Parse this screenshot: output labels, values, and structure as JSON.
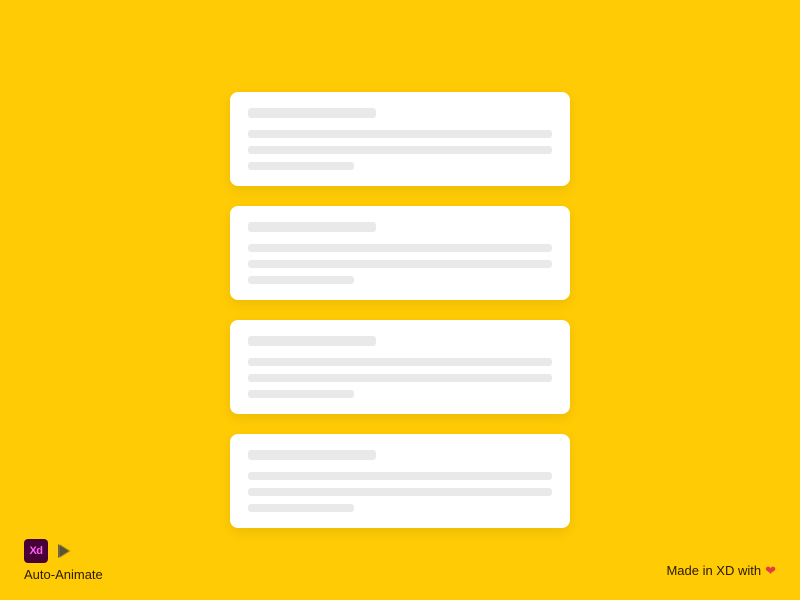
{
  "cards": [
    {
      "title_width": "42%",
      "line3_width": "35%"
    },
    {
      "title_width": "42%",
      "line3_width": "35%"
    },
    {
      "title_width": "42%",
      "line3_width": "35%"
    },
    {
      "title_width": "42%",
      "line3_width": "35%"
    }
  ],
  "footer": {
    "xd_label": "Xd",
    "auto_animate": "Auto-Animate",
    "made_in": "Made in XD with",
    "heart": "❤"
  },
  "colors": {
    "background": "#FFCB05",
    "card": "#FFFFFF",
    "skeleton": "#E9E9E9",
    "xd_bg": "#470137",
    "xd_fg": "#FF61F6",
    "heart": "#E63946"
  }
}
